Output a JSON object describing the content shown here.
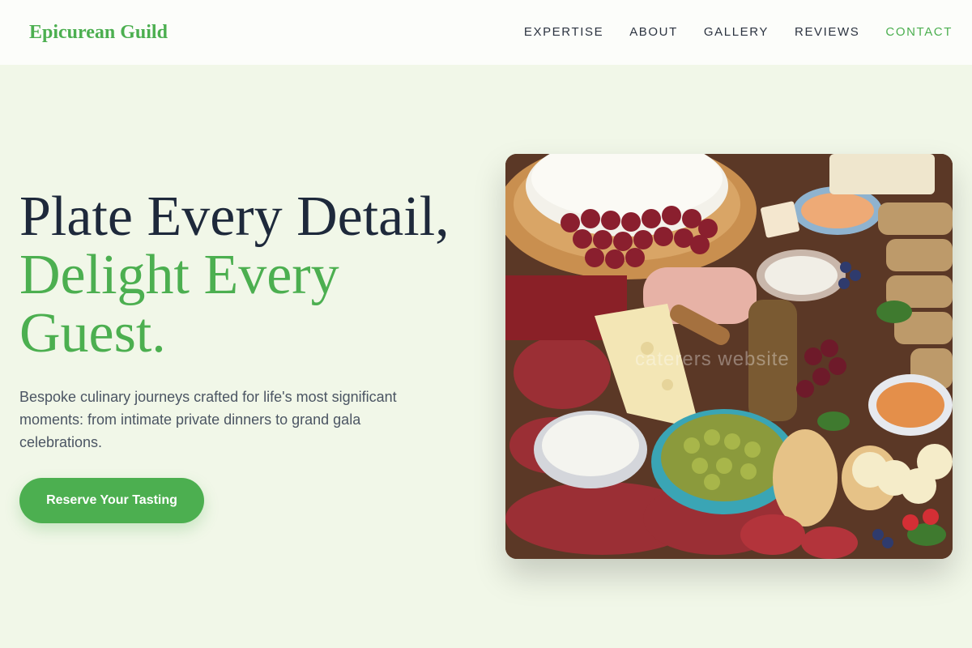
{
  "brand": {
    "name": "Epicurean Guild",
    "accent_color": "#4caf50"
  },
  "nav": {
    "items": [
      {
        "label": "EXPERTISE"
      },
      {
        "label": "ABOUT"
      },
      {
        "label": "GALLERY"
      },
      {
        "label": "REVIEWS"
      },
      {
        "label": "CONTACT",
        "active": true
      }
    ]
  },
  "hero": {
    "headline_line1": "Plate Every Detail,",
    "headline_line2": "Delight Every",
    "headline_line3": "Guest.",
    "lede": "Bespoke culinary journeys crafted for life's most significant moments: from intimate private dinners to grand gala celebrations.",
    "cta_label": "Reserve Your Tasting",
    "image_watermark": "caterers website"
  },
  "colors": {
    "background": "#f1f7e8",
    "navbar": "#fcfdfa",
    "heading": "#1e293b",
    "body_text": "#4b5563"
  }
}
